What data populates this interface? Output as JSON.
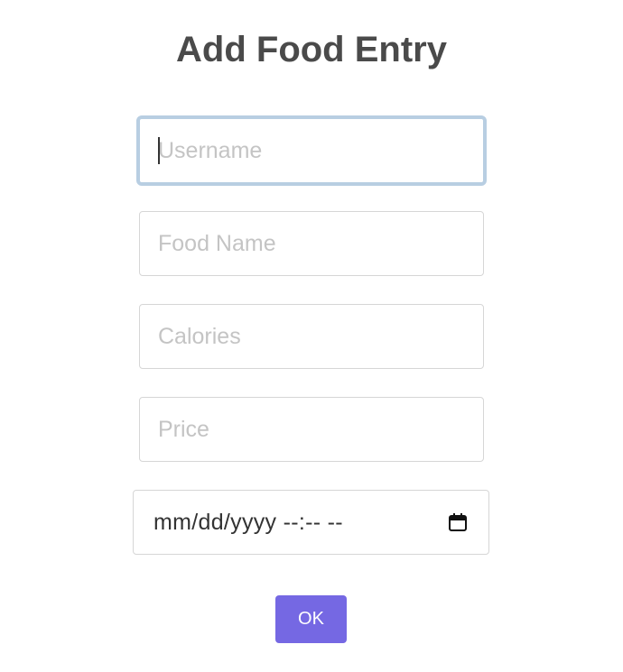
{
  "dialog": {
    "title": "Add Food Entry"
  },
  "form": {
    "username_placeholder": "Username",
    "username_value": "",
    "food_name_placeholder": "Food Name",
    "food_name_value": "",
    "calories_placeholder": "Calories",
    "calories_value": "",
    "price_placeholder": "Price",
    "price_value": "",
    "datetime_display": "mm/dd/yyyy --:-- --",
    "ok_label": "OK"
  },
  "icons": {
    "datetime_picker": "calendar-icon"
  },
  "colors": {
    "title": "#4a4a4a",
    "ok_button": "#7568e3",
    "focus_ring": "#b8cee2",
    "placeholder": "#c4c4c4"
  }
}
